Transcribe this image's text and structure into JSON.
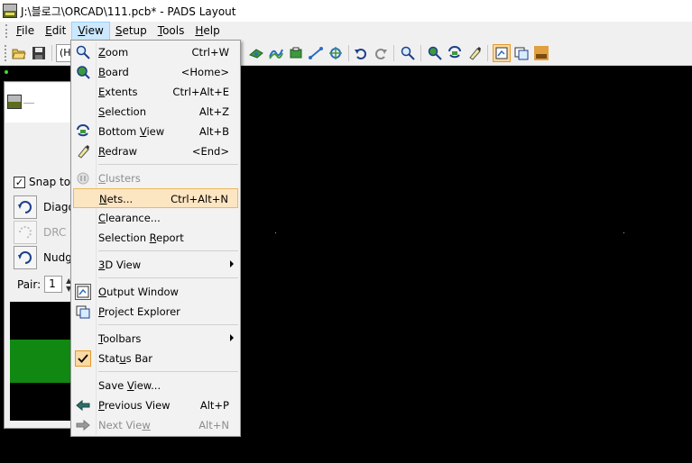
{
  "window": {
    "title": "J:\\블로그\\ORCAD\\111.pcb* - PADS Layout",
    "icon": "pads-app-icon"
  },
  "menubar": [
    {
      "label": "File",
      "ul": "F",
      "rest": "ile"
    },
    {
      "label": "Edit",
      "ul": "E",
      "rest": "dit"
    },
    {
      "label": "View",
      "ul": "V",
      "rest": "iew",
      "active": true
    },
    {
      "label": "Setup",
      "ul": "S",
      "rest": "etup"
    },
    {
      "label": "Tools",
      "ul": "T",
      "rest": "ools"
    },
    {
      "label": "Help",
      "ul": "H",
      "rest": "elp"
    }
  ],
  "toolbar": {
    "combo_value": "(H"
  },
  "side_panel": {
    "snap_label": "Snap to D",
    "snap_checked": "✓",
    "modes": [
      {
        "label": "Diago",
        "enabled": true
      },
      {
        "label": "DRC (",
        "enabled": false
      },
      {
        "label": "Nudge",
        "enabled": true
      }
    ],
    "pair_label": "Pair:",
    "pair_value": "1",
    "spin_up": "▲",
    "spin_down": "▼"
  },
  "view_menu": {
    "items": [
      {
        "pre": "",
        "ul": "Z",
        "post": "oom",
        "shortcut": "Ctrl+W",
        "icon": "zoom-icon"
      },
      {
        "pre": "",
        "ul": "B",
        "post": "oard",
        "shortcut": "<Home>",
        "icon": "board-icon"
      },
      {
        "pre": "",
        "ul": "E",
        "post": "xtents",
        "shortcut": "Ctrl+Alt+E",
        "icon": ""
      },
      {
        "pre": "",
        "ul": "S",
        "post": "election",
        "shortcut": "Alt+Z",
        "icon": ""
      },
      {
        "pre": "Bottom ",
        "ul": "V",
        "post": "iew",
        "shortcut": "Alt+B",
        "icon": "bottom-view-icon"
      },
      {
        "pre": "",
        "ul": "R",
        "post": "edraw",
        "shortcut": "<End>",
        "icon": "redraw-icon"
      },
      {
        "pre": "",
        "ul": "C",
        "post": "lusters",
        "shortcut": "",
        "icon": "clusters-icon",
        "disabled": true
      },
      {
        "pre": "",
        "ul": "N",
        "post": "ets...",
        "shortcut": "Ctrl+Alt+N",
        "icon": "",
        "highlight": true
      },
      {
        "pre": "",
        "ul": "C",
        "post": "learance...",
        "shortcut": "",
        "icon": ""
      },
      {
        "pre": "Selection ",
        "ul": "R",
        "post": "eport",
        "shortcut": "",
        "icon": ""
      },
      {
        "pre": "",
        "ul": "3",
        "post": "D View",
        "shortcut": "",
        "icon": "",
        "submenu": true
      },
      {
        "pre": "",
        "ul": "O",
        "post": "utput Window",
        "shortcut": "",
        "icon": "output-window-icon"
      },
      {
        "pre": "",
        "ul": "P",
        "post": "roject Explorer",
        "shortcut": "",
        "icon": "project-explorer-icon"
      },
      {
        "pre": "",
        "ul": "T",
        "post": "oolbars",
        "shortcut": "",
        "icon": "",
        "submenu": true
      },
      {
        "pre": "Stat",
        "ul": "u",
        "post": "s Bar",
        "shortcut": "",
        "icon": "check-icon",
        "checked": true
      },
      {
        "pre": "Save ",
        "ul": "V",
        "post": "iew...",
        "shortcut": "",
        "icon": ""
      },
      {
        "pre": "",
        "ul": "P",
        "post": "revious View",
        "shortcut": "Alt+P",
        "icon": "previous-view-icon"
      },
      {
        "pre": "Next Vie",
        "ul": "w",
        "post": "",
        "shortcut": "Alt+N",
        "icon": "next-view-icon",
        "disabled": true
      }
    ]
  },
  "colors": {
    "highlight": "#fce5c1",
    "pressed": "#fcd9a3",
    "canvas": "#000000",
    "copper": "#118811"
  }
}
